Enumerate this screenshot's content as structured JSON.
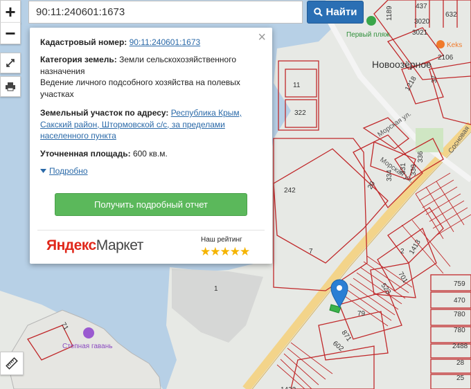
{
  "search": {
    "value": "90:11:240601:1673",
    "button_label": "Найти"
  },
  "controls": {
    "zoom_in": "+",
    "zoom_out": "−"
  },
  "popup": {
    "close": "×",
    "cadastral_label": "Кадастровый номер:",
    "cadastral_value": "90:11:240601:1673",
    "category_label": "Категория земель:",
    "category_value": "Земли сельскохозяйственного назначения",
    "use_value": "Ведение личного подсобного хозяйства на полевых участках",
    "address_label": "Земельный участок по адресу:",
    "address_value": "Республика Крым, Сакский район, Штормовской с/с, за пределами населенного пункта",
    "area_label": "Уточненная площадь:",
    "area_value": "600 кв.м.",
    "more_label": "Подробно",
    "report_button": "Получить подробный отчет",
    "brand_yandex": "Яндекс",
    "brand_market": "Маркет",
    "rating_label": "Наш рейтинг",
    "stars": "★★★★★"
  },
  "map": {
    "places": {
      "beach": "Первый пляж",
      "town": "Новоозёрное",
      "harbor": "Степная гавань",
      "keks": "Keks",
      "street_morskaya": "Морская ул.",
      "street_morskaya2": "Морская ул.",
      "street_sosnovaya": "Сосновая"
    },
    "parcels": [
      "437",
      "632",
      "1189",
      "3020",
      "3021",
      "2106",
      "1218",
      "37",
      "11",
      "322",
      "336",
      "331",
      "330",
      "334",
      "20",
      "242",
      "7",
      "1",
      "2",
      "1413",
      "701",
      "523",
      "79",
      "871",
      "602",
      "71",
      "759",
      "470",
      "780",
      "780",
      "2488",
      "28",
      "25",
      "1422"
    ]
  },
  "colors": {
    "water": "#b5cfe5",
    "land": "#e6e8e4",
    "parcel_line": "#c0282a",
    "road": "#f2d48c",
    "accent": "#2a6fb4",
    "report_green": "#5bb85b",
    "marker": "#2a7fd4"
  }
}
